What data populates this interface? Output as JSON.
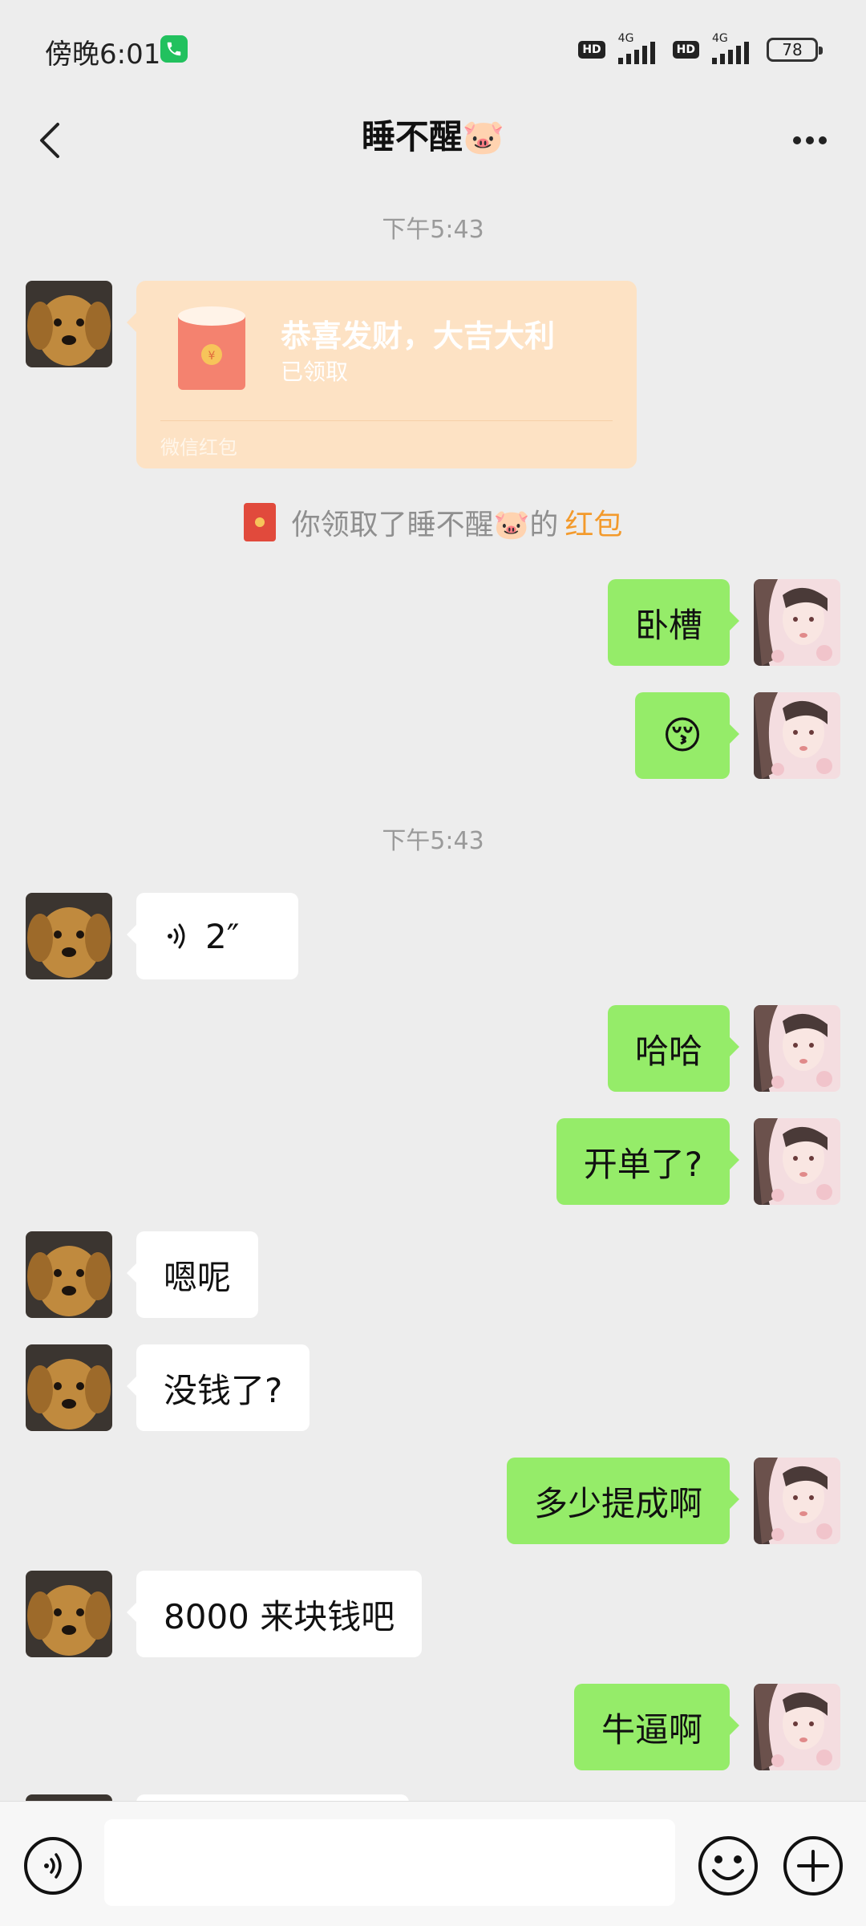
{
  "status_bar": {
    "time": "傍晚6:01",
    "hd1": "HD",
    "net1": "4G",
    "hd2": "HD",
    "net2": "4G",
    "battery": "78"
  },
  "nav": {
    "title": "睡不醒🐷"
  },
  "chat": {
    "timestamp1": "下午5:43",
    "red_packet": {
      "title": "恭喜发财，大吉大利",
      "status": "已领取",
      "footer": "微信红包"
    },
    "system": {
      "prefix": "你领取了睡不醒🐷的",
      "link": "红包"
    },
    "messages_1": {
      "out1": "卧槽",
      "out2": "😚"
    },
    "timestamp2": "下午5:43",
    "voice_duration": "2″",
    "messages_2": {
      "out3": "哈哈",
      "out4": "开单了?",
      "in1": "嗯呢",
      "in2": "没钱了?",
      "out5": "多少提成啊",
      "in3": "8000 来块钱吧",
      "out6": "牛逼啊"
    }
  },
  "input": {
    "placeholder": ""
  },
  "colors": {
    "bg": "#ededed",
    "out_bubble": "#95ec69",
    "in_bubble": "#ffffff",
    "red_packet": "#fde2c4",
    "link": "#f39a2c"
  },
  "icons": [
    "phone-icon",
    "back-icon",
    "more-icon",
    "voice-icon",
    "emoji-icon",
    "plus-icon",
    "red-packet-icon"
  ]
}
